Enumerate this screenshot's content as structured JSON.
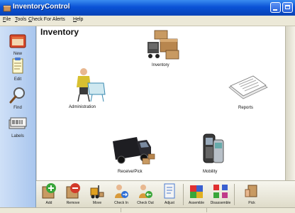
{
  "window": {
    "title": "InventoryControl"
  },
  "menu": [
    {
      "label": "File"
    },
    {
      "label": "Tools"
    },
    {
      "label": "Check For Alerts"
    },
    {
      "label": "Help"
    }
  ],
  "sidebar": {
    "items": [
      {
        "label": "New",
        "icon": "new-document-icon"
      },
      {
        "label": "Edit",
        "icon": "edit-document-icon"
      },
      {
        "label": "Find",
        "icon": "magnifier-icon"
      },
      {
        "label": "Labels",
        "icon": "labels-icon"
      }
    ]
  },
  "main": {
    "title": "Inventory",
    "modules": [
      {
        "label": "Inventory",
        "icon": "boxes-and-cart-icon"
      },
      {
        "label": "Administration",
        "icon": "person-at-desk-icon"
      },
      {
        "label": "Reports",
        "icon": "report-papers-icon"
      },
      {
        "label": "Receive/Pick",
        "icon": "delivery-truck-icon"
      },
      {
        "label": "Mobility",
        "icon": "mobile-devices-icon"
      }
    ]
  },
  "toolbar": {
    "items": [
      {
        "label": "Add",
        "icon": "add-icon",
        "color": "#3aa63a"
      },
      {
        "label": "Remove",
        "icon": "remove-icon",
        "color": "#d23a2a"
      },
      {
        "label": "Move",
        "icon": "move-forklift-icon",
        "color": "#d8a030"
      },
      {
        "label": "Check In",
        "icon": "check-in-icon",
        "color": "#2e6fd6"
      },
      {
        "label": "Check Out",
        "icon": "check-out-icon",
        "color": "#e08a20"
      },
      {
        "label": "Adjust",
        "icon": "adjust-icon",
        "color": "#4a7bd0"
      },
      {
        "label": "Assemble",
        "icon": "assemble-icon",
        "color": "#e0b020"
      },
      {
        "label": "Disassemble",
        "icon": "disassemble-icon",
        "color": "#c03a8a"
      },
      {
        "label": "Pick",
        "icon": "pick-icon",
        "color": "#d89a3a"
      }
    ]
  }
}
